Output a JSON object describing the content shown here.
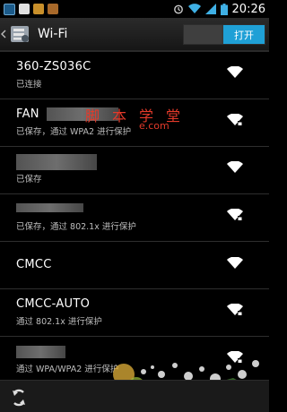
{
  "status_bar": {
    "time": "20:26",
    "left_icons": [
      "photo-icon",
      "dialog-icon",
      "image-icon",
      "package-icon"
    ],
    "right_icons": [
      "alarm-icon",
      "wifi-signal-icon",
      "cell-signal-icon",
      "battery-icon"
    ]
  },
  "action_bar": {
    "title": "Wi-Fi",
    "toggle_label": "打开"
  },
  "networks": [
    {
      "name": "360-ZS036C",
      "status": "已连接",
      "locked": false
    },
    {
      "name": "FAN",
      "status": "已保存，通过 WPA2 进行保护",
      "locked": true
    },
    {
      "name": "",
      "status": "已保存",
      "locked": false
    },
    {
      "name": "",
      "status": "已保存，通过 802.1x 进行保护",
      "locked": true
    },
    {
      "name": "CMCC",
      "status": "",
      "locked": false
    },
    {
      "name": "CMCC-AUTO",
      "status": "通过 802.1x 进行保护",
      "locked": true
    },
    {
      "name": "",
      "status": "通过 WPA/WPA2 进行保护",
      "locked": true
    }
  ],
  "watermark": {
    "line1": "脚本学堂",
    "line2": "e.com"
  },
  "colors": {
    "accent": "#1fa0d6",
    "watermark": "#e43a2a"
  }
}
